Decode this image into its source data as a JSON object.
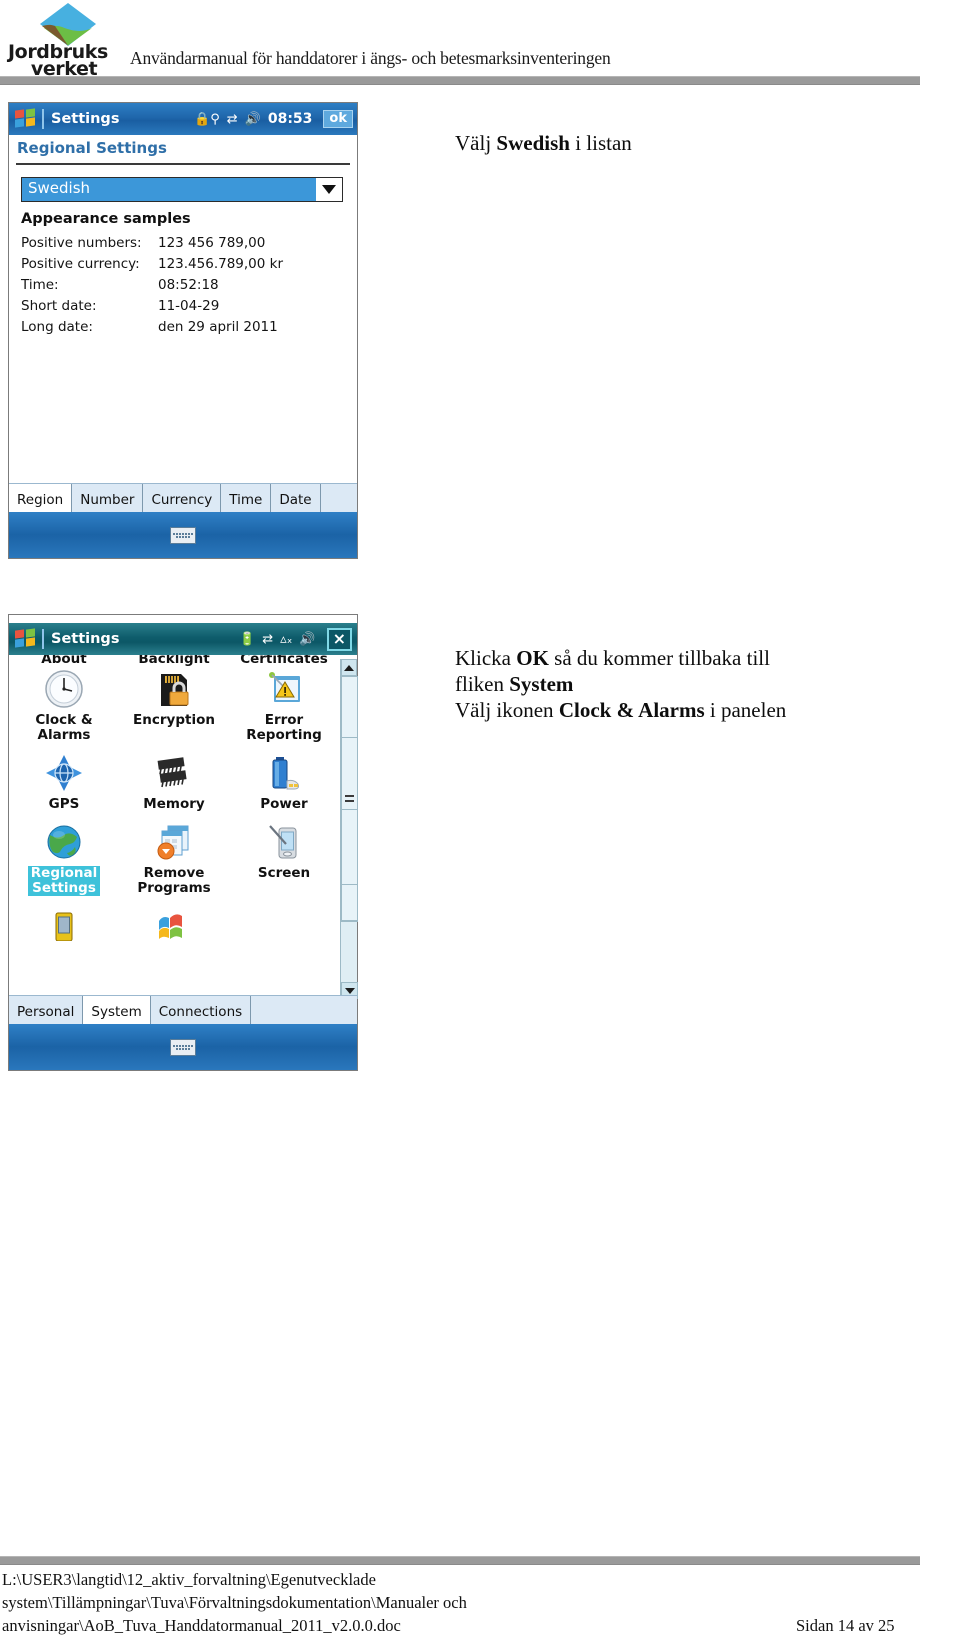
{
  "header": {
    "logo_line1": "Jordbruks",
    "logo_line2": "verket",
    "title": "Användarmanual för handdatorer i ängs- och betesmarksinventeringen"
  },
  "screen_regional": {
    "titlebar": {
      "title": "Settings",
      "icon_lock": "lock-key-icon",
      "icon_connectivity": "connectivity-icon",
      "icon_volume": "volume-icon",
      "time": "08:53",
      "ok_label": "ok"
    },
    "page_title": "Regional Settings",
    "language_combo": {
      "value": "Swedish",
      "arrow": "chevron-down-icon"
    },
    "samples_heading": "Appearance samples",
    "samples": [
      {
        "label": "Positive numbers:",
        "value": "123 456 789,00"
      },
      {
        "label": "Positive currency:",
        "value": "123.456.789,00 kr"
      },
      {
        "label": "Time:",
        "value": "08:52:18"
      },
      {
        "label": "Short date:",
        "value": "11-04-29"
      },
      {
        "label": "Long date:",
        "value": "den 29 april 2011"
      }
    ],
    "tabs": [
      {
        "label": "Region",
        "active": true
      },
      {
        "label": "Number",
        "active": false
      },
      {
        "label": "Currency",
        "active": false
      },
      {
        "label": "Time",
        "active": false
      },
      {
        "label": "Date",
        "active": false
      }
    ],
    "sip_icon": "keyboard-icon"
  },
  "screen_settings": {
    "titlebar": {
      "title": "Settings",
      "icon_battery": "battery-icon",
      "icon_connectivity": "connectivity-icon",
      "icon_signal_off": "signal-off-icon",
      "icon_volume": "volume-icon",
      "close_label": "×"
    },
    "ghost_row": [
      "About",
      "Backlight",
      "Certificates"
    ],
    "icons": [
      {
        "caption": "Clock &\nAlarms",
        "icon": "clock-icon",
        "selected": false
      },
      {
        "caption": "Encryption",
        "icon": "encryption-card-lock-icon",
        "selected": false
      },
      {
        "caption": "Error\nReporting",
        "icon": "error-reporting-icon",
        "selected": false
      },
      {
        "caption": "GPS",
        "icon": "gps-icon",
        "selected": false
      },
      {
        "caption": "Memory",
        "icon": "memory-chip-icon",
        "selected": false
      },
      {
        "caption": "Power",
        "icon": "battery-power-icon",
        "selected": false
      },
      {
        "caption": "Regional\nSettings",
        "icon": "globe-icon",
        "selected": true
      },
      {
        "caption": "Remove\nPrograms",
        "icon": "remove-programs-icon",
        "selected": false
      },
      {
        "caption": "Screen",
        "icon": "screen-stylus-icon",
        "selected": false
      }
    ],
    "partial_icons": [
      {
        "icon": "device-icon"
      },
      {
        "icon": "windows-flag-icon"
      }
    ],
    "scrollbar": {
      "up": "scroll-up-arrow-icon",
      "down": "scroll-down-arrow-icon",
      "thumb": "scroll-thumb-grip"
    },
    "tabs": [
      {
        "label": "Personal",
        "active": false
      },
      {
        "label": "System",
        "active": true
      },
      {
        "label": "Connections",
        "active": false
      }
    ],
    "sip_icon": "keyboard-icon"
  },
  "annotations": {
    "one": {
      "pre": "Välj ",
      "bold": "Swedish",
      "post": " i listan"
    },
    "two": {
      "line1_pre": "Klicka ",
      "line1_bold": "OK",
      "line1_post": " så du kommer tillbaka till",
      "line2_pre": "fliken ",
      "line2_bold": "System",
      "line3_pre": "Välj ikonen ",
      "line3_bold": "Clock & Alarms",
      "line3_post": " i panelen"
    }
  },
  "footer": {
    "path_line1": "L:\\USER3\\langtid\\12_aktiv_forvaltning\\Egenutvecklade",
    "path_line2": "system\\Tillämpningar\\Tuva\\Förvaltningsdokumentation\\Manualer och",
    "path_line3": "anvisningar\\AoB_Tuva_Handdatormanual_2011_v2.0.0.doc",
    "page": "Sidan 14 av 25"
  }
}
